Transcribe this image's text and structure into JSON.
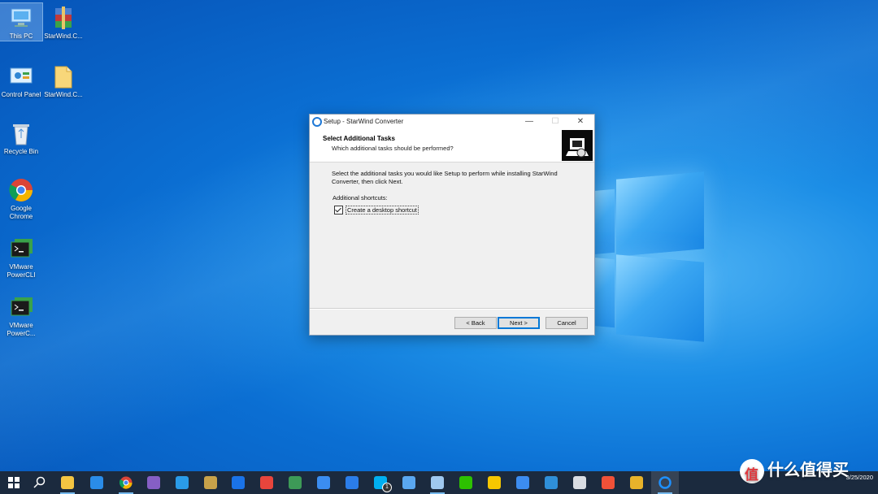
{
  "desktop": {
    "icons": [
      {
        "label": "This PC",
        "icon": "this-pc-icon"
      },
      {
        "label": "StarWind.C...",
        "icon": "winrar-archive-icon"
      },
      {
        "label": "Control Panel",
        "icon": "control-panel-icon"
      },
      {
        "label": "StarWind.C...",
        "icon": "folder-icon"
      },
      {
        "label": "Recycle Bin",
        "icon": "recycle-bin-icon"
      },
      {
        "label": "Google Chrome",
        "icon": "chrome-icon"
      },
      {
        "label": "VMware PowerCLI",
        "icon": "powercli-icon"
      },
      {
        "label": "VMware PowerC...",
        "icon": "powercli-icon"
      }
    ]
  },
  "dialog": {
    "title": "Setup - StarWind Converter",
    "controls": {
      "minimize": "—",
      "maximize": "☐",
      "close": "✕"
    },
    "header_title": "Select Additional Tasks",
    "header_subtitle": "Which additional tasks should be performed?",
    "instructions": "Select the additional tasks you would like Setup to perform while installing StarWind Converter, then click Next.",
    "group_label": "Additional shortcuts:",
    "checkbox": {
      "label": "Create a desktop shortcut",
      "checked": true
    },
    "buttons": {
      "back": "< Back",
      "next": "Next >",
      "cancel": "Cancel"
    }
  },
  "taskbar": {
    "apps": [
      {
        "name": "start",
        "color": "#ffffff"
      },
      {
        "name": "search",
        "color": "#ffffff"
      },
      {
        "name": "file-explorer",
        "color": "#f4c542"
      },
      {
        "name": "mail",
        "color": "#2a8ce8"
      },
      {
        "name": "chrome",
        "color": "#db4437"
      },
      {
        "name": "visual-studio",
        "color": "#865fc5"
      },
      {
        "name": "vscode",
        "color": "#2a9be8"
      },
      {
        "name": "tools",
        "color": "#c8a24a"
      },
      {
        "name": "maps",
        "color": "#1a73e8"
      },
      {
        "name": "app-grid",
        "color": "#e8453c"
      },
      {
        "name": "sourcetree",
        "color": "#3d9a57"
      },
      {
        "name": "note",
        "color": "#3b8df0"
      },
      {
        "name": "bookmark",
        "color": "#2b7de9"
      },
      {
        "name": "skype",
        "color": "#00aff0"
      },
      {
        "name": "mail-app",
        "color": "#5aa7f0"
      },
      {
        "name": "remote-desktop",
        "color": "#9fc8ef"
      },
      {
        "name": "wechat",
        "color": "#2dc100"
      },
      {
        "name": "norton",
        "color": "#f6c700"
      },
      {
        "name": "baidu-netdisk",
        "color": "#3c8cf0"
      },
      {
        "name": "edge",
        "color": "#2f8fd8"
      },
      {
        "name": "remote-app",
        "color": "#d9dde3"
      },
      {
        "name": "swift",
        "color": "#f05138"
      },
      {
        "name": "slack",
        "color": "#e8b32a"
      },
      {
        "name": "starwind-setup",
        "color": "#1e90ff"
      }
    ],
    "skype_badge": "1",
    "clock_time": "",
    "clock_date": "3/25/2020"
  },
  "watermark": {
    "text": "什么值得买"
  }
}
